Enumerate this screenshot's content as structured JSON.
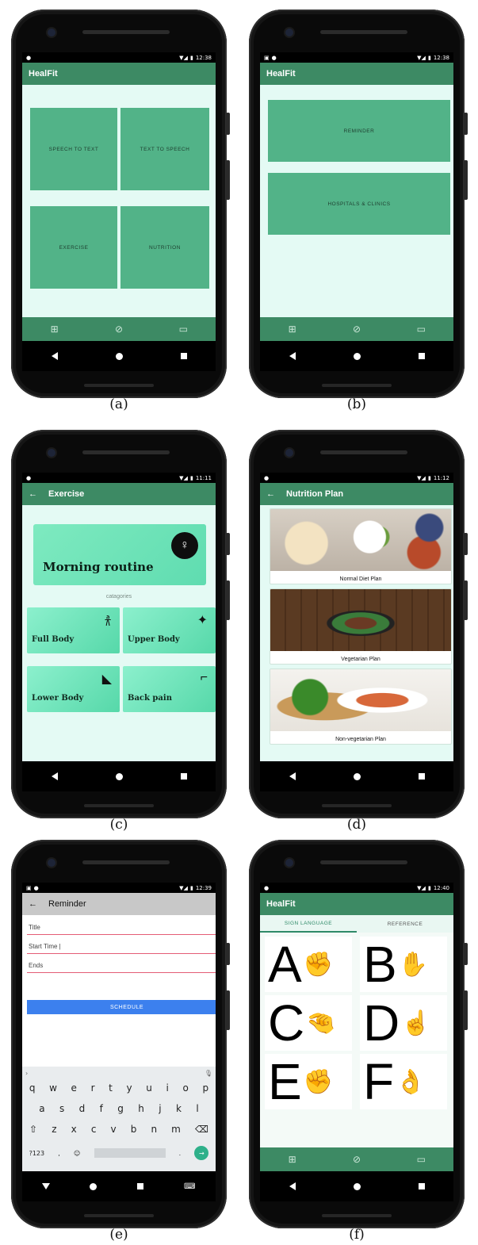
{
  "captions": [
    "(a)",
    "(b)",
    "(c)",
    "(d)",
    "(e)",
    "(f)"
  ],
  "status_times": {
    "a": "12:38",
    "b": "12:38",
    "c": "11:11",
    "d": "11:12",
    "e": "12:39",
    "f": "12:40"
  },
  "app_name": "HealFit",
  "screen_a": {
    "tiles": [
      "SPEECH TO TEXT",
      "TEXT TO SPEECH",
      "EXERCISE",
      "NUTRITION"
    ]
  },
  "screen_b": {
    "buttons": [
      "REMINDER",
      "HOSPITALS & CLINICS"
    ]
  },
  "screen_c": {
    "title": "Exercise",
    "hero": "Morning routine",
    "categories_label": "catagories",
    "cards": [
      "Full Body",
      "Upper Body",
      "Lower Body",
      "Back pain"
    ]
  },
  "screen_d": {
    "title": "Nutrition Plan",
    "plans": [
      "Normal Diet Plan",
      "Vegetarian Plan",
      "Non-vegetarian Plan"
    ]
  },
  "screen_e": {
    "title": "Reminder",
    "fields": [
      "Title",
      "Start Time |",
      "Ends"
    ],
    "button": "SCHEDULE",
    "keyboard": {
      "row1": [
        "q",
        "w",
        "e",
        "r",
        "t",
        "y",
        "u",
        "i",
        "o",
        "p"
      ],
      "row2": [
        "a",
        "s",
        "d",
        "f",
        "g",
        "h",
        "j",
        "k",
        "l"
      ],
      "row3": [
        "z",
        "x",
        "c",
        "v",
        "b",
        "n",
        "m"
      ],
      "symbols_key": "?123"
    }
  },
  "screen_f": {
    "tabs": [
      "SIGN LANGUAGE",
      "REFERENCE"
    ],
    "letters": [
      "A",
      "B",
      "C",
      "D",
      "E",
      "F"
    ]
  },
  "colors": {
    "primary": "#3d8a64",
    "tile": "#52b388",
    "screen_bg": "#e4faf4",
    "accent_blue": "#3c80ee"
  },
  "icons": [
    "grid-icon",
    "compass-icon",
    "book-icon",
    "back-arrow-icon",
    "wifi-icon",
    "battery-icon"
  ]
}
